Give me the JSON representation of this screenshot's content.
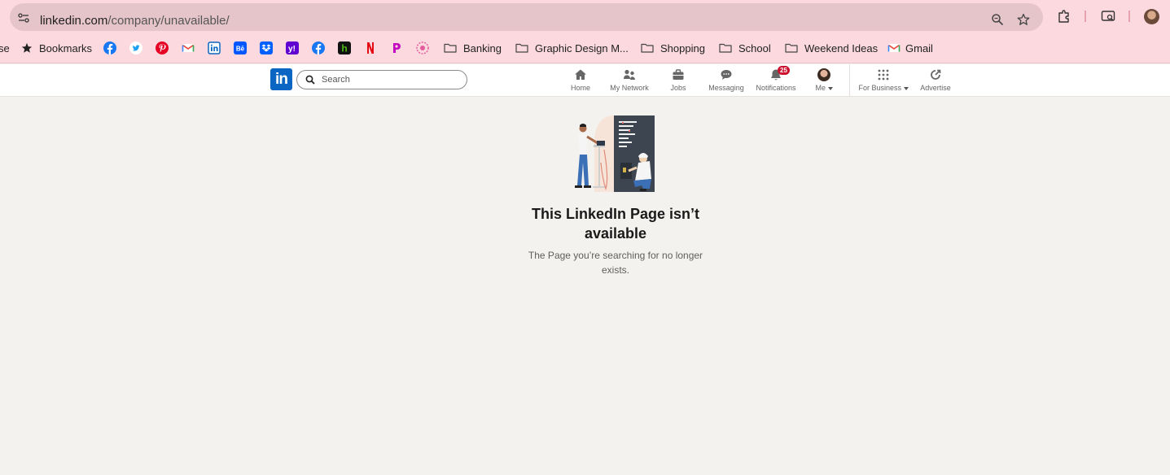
{
  "browser": {
    "url_host": "linkedin.com",
    "url_path": "/company/unavailable/",
    "bookmarks": {
      "partial_left": "se",
      "bookmarks_label": "Bookmarks",
      "folders": [
        "Banking",
        "Graphic Design M...",
        "Shopping",
        "School",
        "Weekend Ideas"
      ],
      "gmail_label": "Gmail"
    }
  },
  "linkedin": {
    "logo": "in",
    "search_placeholder": "Search",
    "nav": {
      "home": "Home",
      "network": "My Network",
      "jobs": "Jobs",
      "messaging": "Messaging",
      "notifications": "Notifications",
      "notifications_count": "25",
      "me": "Me",
      "for_business": "For Business",
      "advertise": "Advertise"
    }
  },
  "main": {
    "title": "This LinkedIn Page isn’t available",
    "subtitle": "The Page you’re searching for no longer exists."
  },
  "colors": {
    "chrome_bg": "#fbd9df",
    "omnibox": "#e5c4ca",
    "linkedin_blue": "#0a66c2",
    "badge_red": "#cb112d",
    "page_bg": "#f4f2ee"
  }
}
